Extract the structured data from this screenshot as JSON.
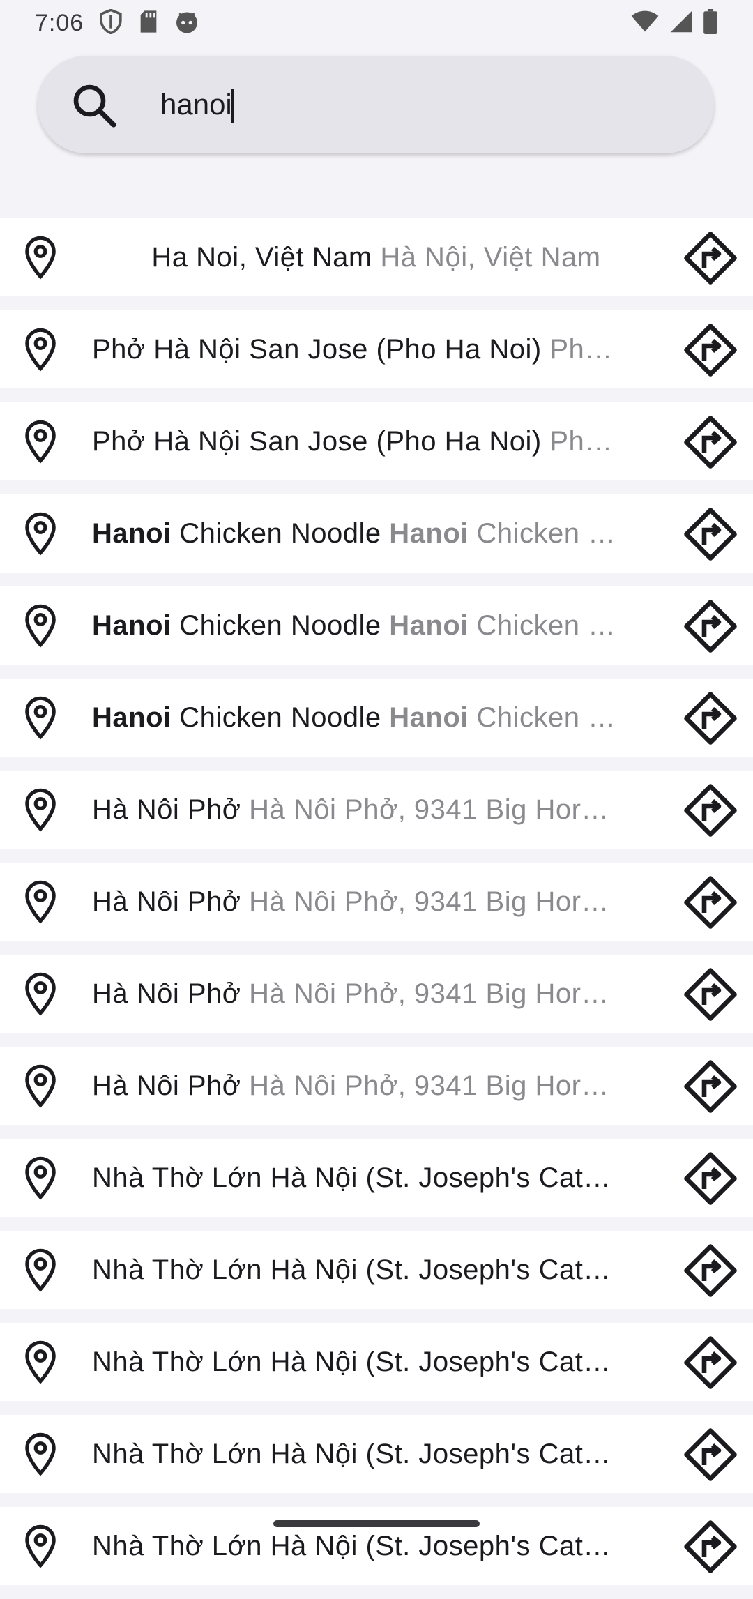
{
  "status_bar": {
    "time": "7:06",
    "left_icons": [
      "shield-icon",
      "sd-card-icon",
      "android-face-icon"
    ],
    "right_icons": [
      "wifi-icon",
      "signal-icon",
      "battery-icon"
    ]
  },
  "search": {
    "value": "hanoi",
    "placeholder": ""
  },
  "results": [
    {
      "primary_bold": "",
      "primary": "Ha Noi, Việt Nam",
      "secondary_bold": "",
      "secondary": "Hà Nội, Việt Nam"
    },
    {
      "primary_bold": "",
      "primary": "Phở Hà Nội San Jose (Pho Ha Noi)",
      "secondary_bold": "",
      "secondary": "Ph…"
    },
    {
      "primary_bold": "",
      "primary": "Phở Hà Nội San Jose (Pho Ha Noi)",
      "secondary_bold": "",
      "secondary": "Ph…"
    },
    {
      "primary_bold": "Hanoi",
      "primary": "Chicken Noodle",
      "secondary_bold": "Hanoi",
      "secondary": "Chicken …"
    },
    {
      "primary_bold": "Hanoi",
      "primary": "Chicken Noodle",
      "secondary_bold": "Hanoi",
      "secondary": "Chicken …"
    },
    {
      "primary_bold": "Hanoi",
      "primary": "Chicken Noodle",
      "secondary_bold": "Hanoi",
      "secondary": "Chicken …"
    },
    {
      "primary_bold": "",
      "primary": "Hà Nôi Phở",
      "secondary_bold": "",
      "secondary": "Hà Nôi Phở, 9341 Big Hor…"
    },
    {
      "primary_bold": "",
      "primary": "Hà Nôi Phở",
      "secondary_bold": "",
      "secondary": "Hà Nôi Phở, 9341 Big Hor…"
    },
    {
      "primary_bold": "",
      "primary": "Hà Nôi Phở",
      "secondary_bold": "",
      "secondary": "Hà Nôi Phở, 9341 Big Hor…"
    },
    {
      "primary_bold": "",
      "primary": "Hà Nôi Phở",
      "secondary_bold": "",
      "secondary": "Hà Nôi Phở, 9341 Big Hor…"
    },
    {
      "primary_bold": "",
      "primary": "Nhà Thờ Lớn Hà Nội (St. Joseph's Cat…",
      "secondary_bold": "",
      "secondary": ""
    },
    {
      "primary_bold": "",
      "primary": "Nhà Thờ Lớn Hà Nội (St. Joseph's Cat…",
      "secondary_bold": "",
      "secondary": ""
    },
    {
      "primary_bold": "",
      "primary": "Nhà Thờ Lớn Hà Nội (St. Joseph's Cat…",
      "secondary_bold": "",
      "secondary": ""
    },
    {
      "primary_bold": "",
      "primary": "Nhà Thờ Lớn Hà Nội (St. Joseph's Cat…",
      "secondary_bold": "",
      "secondary": ""
    },
    {
      "primary_bold": "",
      "primary": "Nhà Thờ Lớn Hà Nội (St. Joseph's Cat…",
      "secondary_bold": "",
      "secondary": ""
    }
  ],
  "icons": {
    "row_leading": "location-pin-icon",
    "row_trailing": "directions-icon"
  },
  "colors": {
    "background": "#f4f3f7",
    "row_background": "#ffffff",
    "search_background": "#e5e4ea",
    "primary_text": "#1b1b1f",
    "secondary_text": "#8a8a8e"
  }
}
